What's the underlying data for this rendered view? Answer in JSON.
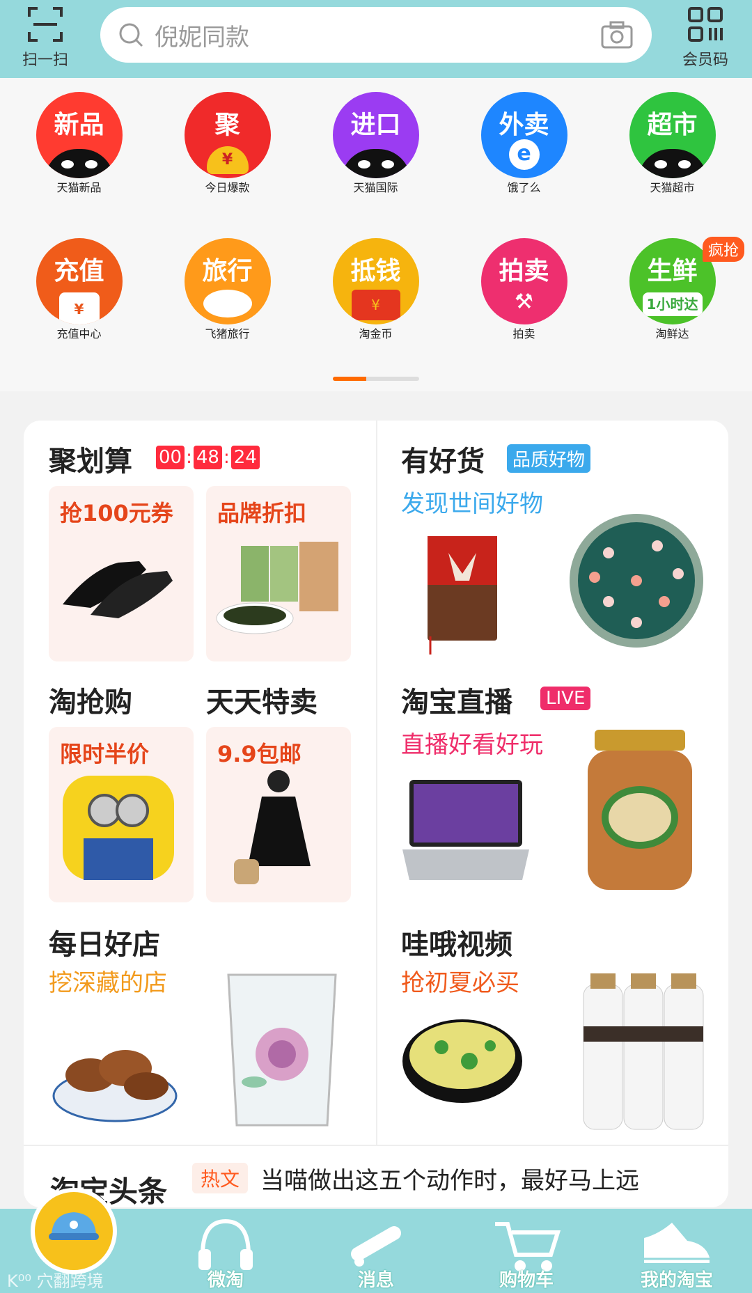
{
  "header": {
    "scan_label": "扫一扫",
    "search_placeholder": "倪妮同款",
    "member_label": "会员码"
  },
  "grid": {
    "items": [
      {
        "circle_text": "新品",
        "label": "天猫新品",
        "color": "#ff3b30"
      },
      {
        "circle_text": "聚",
        "label": "今日爆款",
        "color": "#f02a2a"
      },
      {
        "circle_text": "进口",
        "label": "天猫国际",
        "color": "#9b3cf2"
      },
      {
        "circle_text": "外卖",
        "label": "饿了么",
        "color": "#1e86ff"
      },
      {
        "circle_text": "超市",
        "label": "天猫超市",
        "color": "#2fc43f"
      },
      {
        "circle_text": "充值",
        "label": "充值中心",
        "color": "#f05c1a"
      },
      {
        "circle_text": "旅行",
        "label": "飞猪旅行",
        "color": "#ff9a1a"
      },
      {
        "circle_text": "抵钱",
        "label": "淘金币",
        "color": "#f6b40e"
      },
      {
        "circle_text": "拍卖",
        "label": "拍卖",
        "color": "#ee2f6f"
      },
      {
        "circle_text": "生鲜",
        "label": "淘鲜达",
        "color": "#4cc229",
        "badge": "疯抢"
      }
    ],
    "page_indicator": {
      "current": 1,
      "total": 2
    }
  },
  "card": {
    "juhuasuan": {
      "title": "聚划算",
      "timer": {
        "h": "00",
        "m": "48",
        "s": "24"
      },
      "tile1": "抢100元券",
      "tile2": "品牌折扣"
    },
    "youhaohuo": {
      "title": "有好货",
      "tag": "品质好物",
      "subtitle": "发现世间好物"
    },
    "taoqianggou": {
      "title": "淘抢购",
      "tile": "限时半价"
    },
    "tiantian": {
      "title": "天天特卖",
      "tile": "9.9包邮"
    },
    "live": {
      "title": "淘宝直播",
      "tag": "LIVE",
      "subtitle": "直播好看好玩"
    },
    "shop": {
      "title": "每日好店",
      "subtitle": "挖深藏的店"
    },
    "video": {
      "title": "哇哦视频",
      "subtitle": "抢初夏必买"
    }
  },
  "news": {
    "title": "淘宝头条",
    "tag": "热文",
    "text": "当喵做出这五个动作时，最好马上远"
  },
  "tabbar": {
    "items": [
      {
        "label": ""
      },
      {
        "label": "微淘"
      },
      {
        "label": "消息"
      },
      {
        "label": "购物车"
      },
      {
        "label": "我的淘宝"
      }
    ]
  },
  "watermark": "K⁰⁰ 穴翻跨境"
}
